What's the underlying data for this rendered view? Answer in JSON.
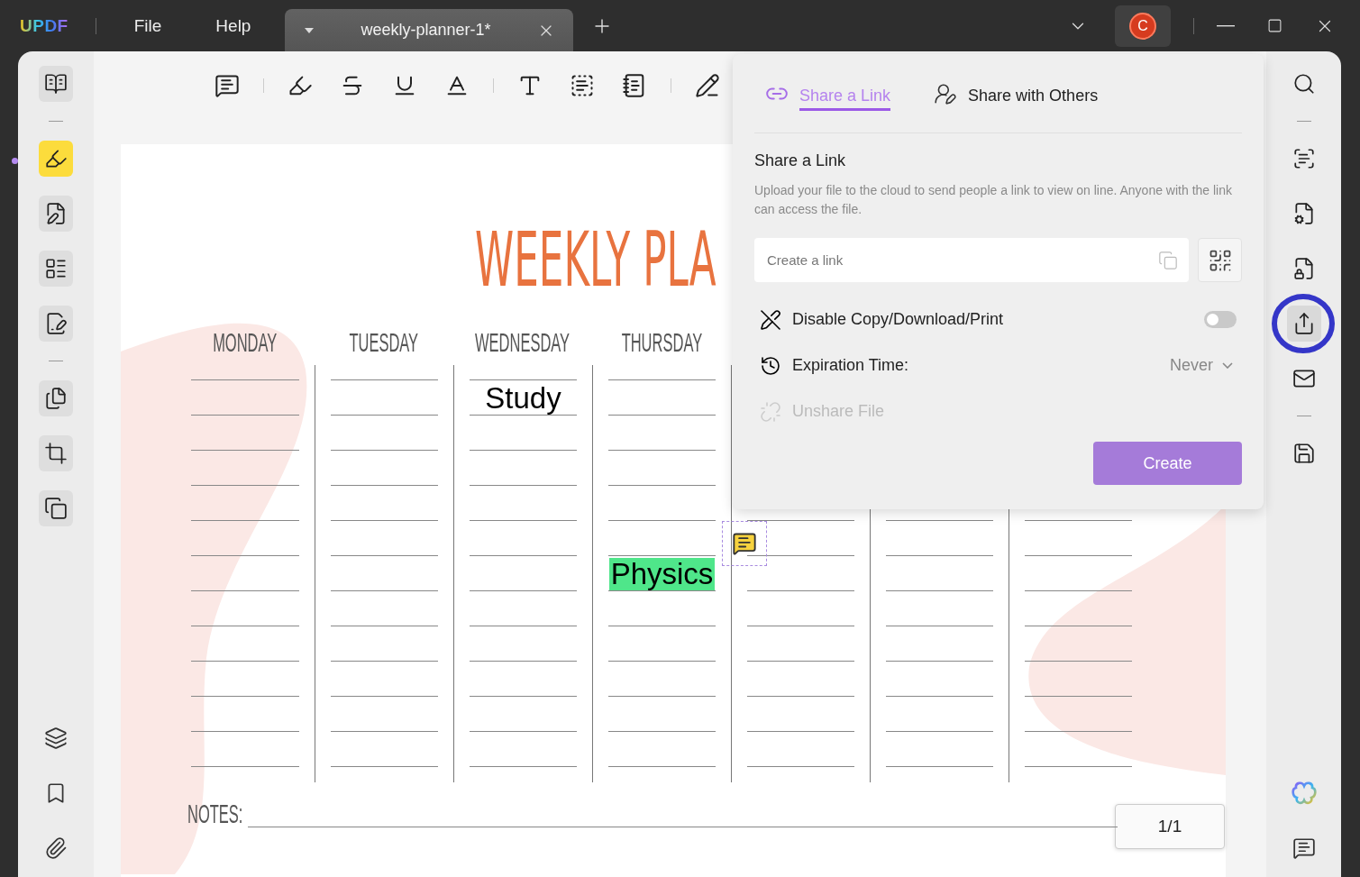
{
  "app": {
    "logo": "UPDF",
    "menu": [
      {
        "label": "File"
      },
      {
        "label": "Help"
      }
    ]
  },
  "document_tab": {
    "title": "weekly-planner-1*"
  },
  "user": {
    "initial": "C"
  },
  "left_sidebar": {
    "tools": [
      {
        "selected": false
      },
      {
        "selected": true
      },
      {
        "selected": false
      },
      {
        "selected": false
      },
      {
        "selected": false
      },
      {
        "selected": false
      },
      {
        "selected": false
      },
      {
        "selected": false
      }
    ]
  },
  "right_sidebar": {
    "tools": [
      {
        "selected": false
      },
      {
        "selected": false
      },
      {
        "selected": false
      },
      {
        "selected": false
      },
      {
        "selected": true
      },
      {
        "selected": false
      },
      {
        "selected": false
      }
    ]
  },
  "page": {
    "title": "WEEKLY PLA",
    "columns": [
      {
        "day": "MONDAY"
      },
      {
        "day": "TUESDAY"
      },
      {
        "day": "WEDNESDAY",
        "notes": [
          {
            "text": "Study",
            "highlighted": false
          }
        ]
      },
      {
        "day": "THURSDAY",
        "notes": [
          {
            "text": "Physics",
            "highlighted": true
          }
        ]
      }
    ],
    "notes_label": "NOTES:",
    "page_indicator": "1/1"
  },
  "share_panel": {
    "tabs": [
      {
        "label": "Share a Link",
        "selected": true
      },
      {
        "label": "Share with Others",
        "selected": false
      }
    ],
    "heading": "Share a Link",
    "description": "Upload your file to the cloud to send people a link to view on line. Anyone with the link can access the file.",
    "link_field": {
      "placeholder": "Create a link"
    },
    "options": [
      {
        "kind": "toggle",
        "label": "Disable Copy/Download/Print",
        "on": false
      },
      {
        "kind": "select",
        "label": "Expiration Time:",
        "value": "Never"
      },
      {
        "kind": "action",
        "label": "Unshare File",
        "disabled": true
      }
    ],
    "create_button": "Create"
  }
}
